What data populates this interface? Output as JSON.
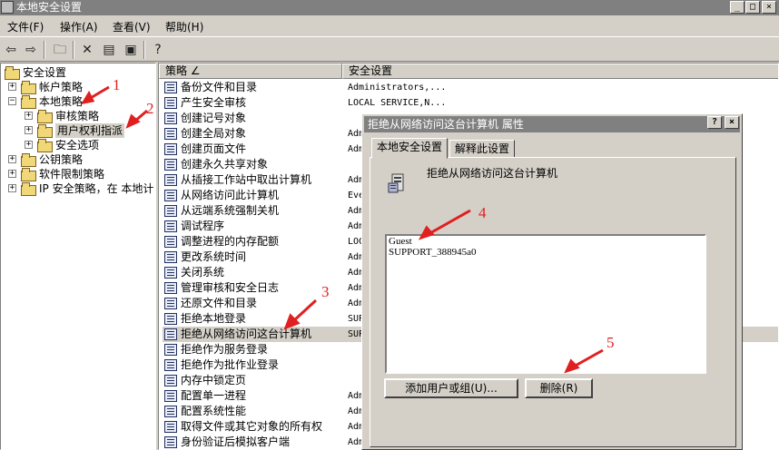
{
  "window": {
    "title": "本地安全设置"
  },
  "menu": [
    "文件(F)",
    "操作(A)",
    "查看(V)",
    "帮助(H)"
  ],
  "toolbar_icons": [
    "back-icon",
    "forward-icon",
    "up-folder-icon",
    "delete-icon",
    "properties-icon",
    "export-icon",
    "help-icon"
  ],
  "tree": [
    {
      "label": "安全设置",
      "level": 0
    },
    {
      "label": "帐户策略",
      "level": 1
    },
    {
      "label": "本地策略",
      "level": 1
    },
    {
      "label": "审核策略",
      "level": 2
    },
    {
      "label": "用户权利指派",
      "level": 2,
      "selected": true
    },
    {
      "label": "安全选项",
      "level": 2
    },
    {
      "label": "公钥策略",
      "level": 1
    },
    {
      "label": "软件限制策略",
      "level": 1
    },
    {
      "label": "IP 安全策略，在 本地计",
      "level": 1
    }
  ],
  "list": {
    "columns": [
      "策略 ∠",
      "安全设置"
    ],
    "rows": [
      {
        "name": "备份文件和目录",
        "value": "Administrators,..."
      },
      {
        "name": "产生安全审核",
        "value": "LOCAL SERVICE,N..."
      },
      {
        "name": "创建记号对象",
        "value": ""
      },
      {
        "name": "创建全局对象",
        "value": "Adm"
      },
      {
        "name": "创建页面文件",
        "value": "Adm"
      },
      {
        "name": "创建永久共享对象",
        "value": ""
      },
      {
        "name": "从插接工作站中取出计算机",
        "value": "Adm"
      },
      {
        "name": "从网络访问此计算机",
        "value": "Eve"
      },
      {
        "name": "从远端系统强制关机",
        "value": "Adm"
      },
      {
        "name": "调试程序",
        "value": "Adm"
      },
      {
        "name": "调整进程的内存配额",
        "value": "LOC"
      },
      {
        "name": "更改系统时间",
        "value": "Adm"
      },
      {
        "name": "关闭系统",
        "value": "Adm"
      },
      {
        "name": "管理审核和安全日志",
        "value": "Adm"
      },
      {
        "name": "还原文件和目录",
        "value": "Adm"
      },
      {
        "name": "拒绝本地登录",
        "value": "SUP"
      },
      {
        "name": "拒绝从网络访问这台计算机",
        "value": "SUP",
        "selected": true
      },
      {
        "name": "拒绝作为服务登录",
        "value": ""
      },
      {
        "name": "拒绝作为批作业登录",
        "value": ""
      },
      {
        "name": "内存中锁定页",
        "value": ""
      },
      {
        "name": "配置单一进程",
        "value": "Adm"
      },
      {
        "name": "配置系统性能",
        "value": "Adm"
      },
      {
        "name": "取得文件或其它对象的所有权",
        "value": "Adm"
      },
      {
        "name": "身份验证后模拟客户端",
        "value": "Adm"
      }
    ]
  },
  "dialog": {
    "title": "拒绝从网络访问这台计算机 属性",
    "tabs": [
      "本地安全设置",
      "解释此设置"
    ],
    "policy_label": "拒绝从网络访问这台计算机",
    "users": [
      "Guest",
      "SUPPORT_388945a0"
    ],
    "add_button": "添加用户或组(U)...",
    "remove_button": "删除(R)"
  },
  "annotations": [
    "1",
    "2",
    "3",
    "4",
    "5"
  ],
  "annotation_color": "#e02020"
}
